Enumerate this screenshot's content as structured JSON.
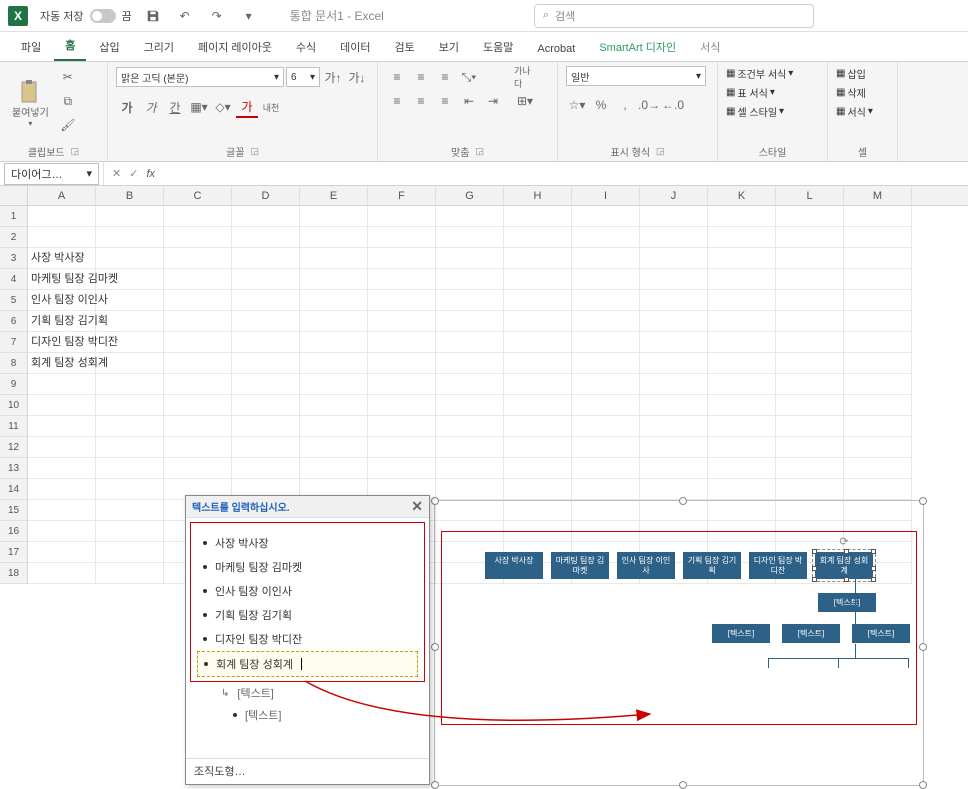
{
  "titlebar": {
    "autosave_label": "자동 저장",
    "autosave_state": "끔",
    "doc_title": "통합 문서1 - Excel",
    "search_placeholder": "검색"
  },
  "tabs": {
    "file": "파일",
    "home": "홈",
    "insert": "삽입",
    "draw": "그리기",
    "layout": "페이지 레이아웃",
    "formulas": "수식",
    "data": "데이터",
    "review": "검토",
    "view": "보기",
    "help": "도움말",
    "acrobat": "Acrobat",
    "smartart": "SmartArt 디자인",
    "format": "서식"
  },
  "ribbon": {
    "clipboard": {
      "label": "클립보드",
      "paste": "붙여넣기"
    },
    "font": {
      "label": "글꼴",
      "name": "맑은 고딕 (본문)",
      "size": "6",
      "bold": "가",
      "italic": "가",
      "underline": "간",
      "color": "가",
      "ganada": "내천"
    },
    "alignment": {
      "label": "맞춤",
      "wrap": "가나다"
    },
    "number": {
      "label": "표시 형식",
      "general": "일반"
    },
    "styles": {
      "label": "스타일",
      "cond": "조건부 서식",
      "table": "표 서식",
      "cell": "셀 스타일"
    },
    "cells": {
      "label": "셀",
      "insert": "삽입",
      "delete": "삭제",
      "format": "서식"
    }
  },
  "namebox": "다이어그…",
  "columns": [
    "A",
    "B",
    "C",
    "D",
    "E",
    "F",
    "G",
    "H",
    "I",
    "J",
    "K",
    "L",
    "M"
  ],
  "rows": [
    1,
    2,
    3,
    4,
    5,
    6,
    7,
    8,
    9,
    10,
    11,
    12,
    13,
    14,
    15,
    16,
    17,
    18
  ],
  "cell_data": {
    "A3": "사장 박사장",
    "A4": "마케팅 팀장 김마켓",
    "A5": "인사 팀장 이인사",
    "A6": "기획 팀장 김기획",
    "A7": "디자인 팀장 박디잔",
    "A8": "회계 팀장 성회계"
  },
  "text_pane": {
    "title": "텍스트를 입력하십시오.",
    "items": [
      "사장 박사장",
      "마케팅 팀장 김마켓",
      "인사 팀장 이인사",
      "기획 팀장 김기획",
      "디자인 팀장 박디잔",
      "회계 팀장 성회계"
    ],
    "placeholder": "[텍스트]",
    "footer": "조직도형…"
  },
  "smartart": {
    "boxes": [
      "사장 박사장",
      "마케팅 팀장 김마켓",
      "인사 팀장 이인사",
      "기획 팀장 김기획",
      "디자인 팀장 박디잔",
      "회계 팀장 성회계"
    ],
    "sub": "[텍스트]"
  }
}
